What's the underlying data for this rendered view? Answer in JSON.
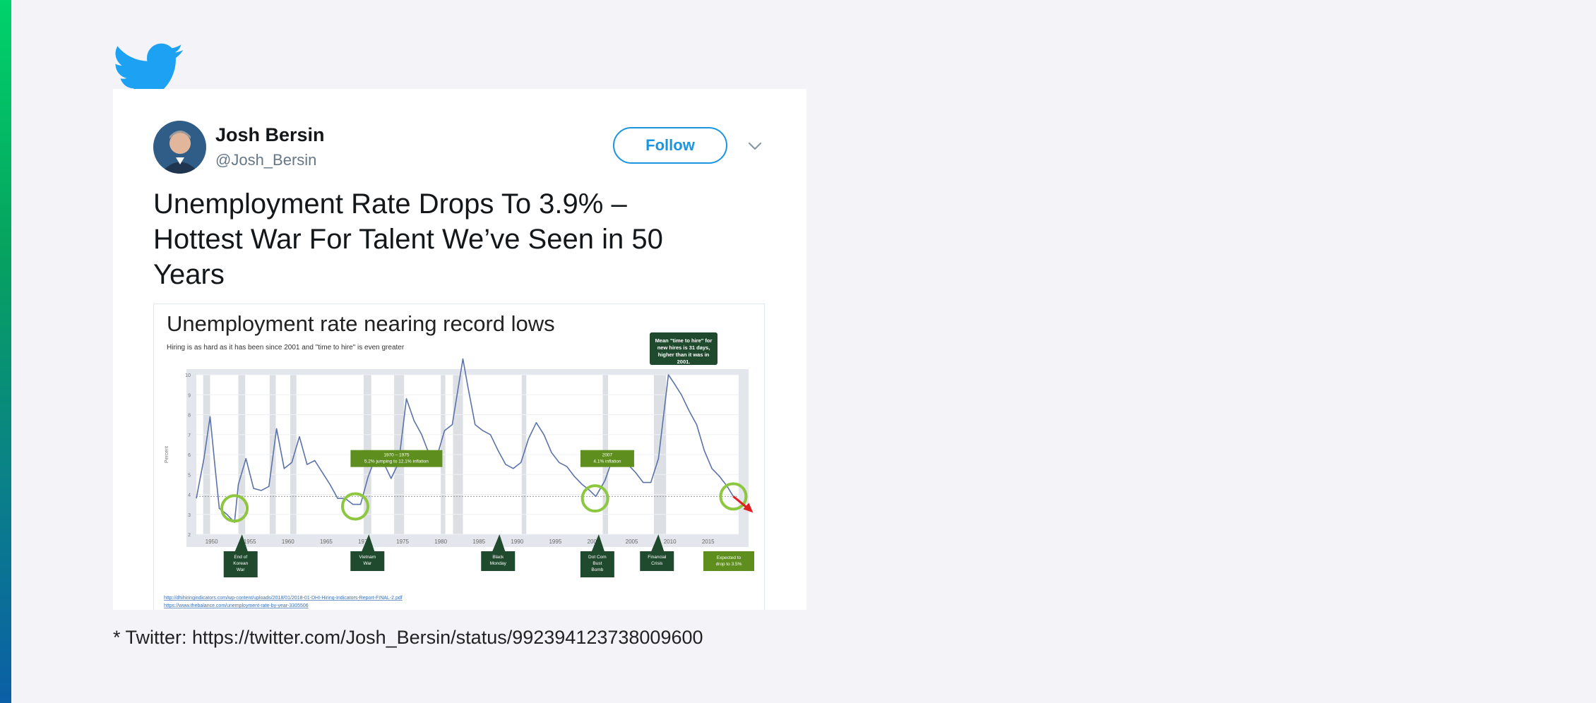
{
  "tweet": {
    "author_name": "Josh Bersin",
    "author_handle": "@Josh_Bersin",
    "follow_label": "Follow",
    "text": "Unemployment Rate Drops To 3.9% – Hottest War For Talent We’ve Seen in 50 Years"
  },
  "caption": "* Twitter: https://twitter.com/Josh_Bersin/status/992394123738009600",
  "colors": {
    "accent": "#1b95e0",
    "chart_line": "#5b73a8",
    "annotation_green": "#5e8f1e",
    "callout_dark": "#1f4a2e"
  },
  "chart_data": {
    "type": "line",
    "title": "Unemployment rate nearing record lows",
    "subtitle": "Hiring is as hard as it has been since 2001 and \"time to hire\" is even greater",
    "ylabel": "Percent",
    "xlim": [
      1948,
      2019
    ],
    "ylim": [
      2,
      10
    ],
    "x_ticks": [
      "1950",
      "1955",
      "1960",
      "1965",
      "1970",
      "1975",
      "1980",
      "1985",
      "1990",
      "1995",
      "2000",
      "2005",
      "2010",
      "2015"
    ],
    "y_ticks": [
      "2",
      "3",
      "4",
      "5",
      "6",
      "7",
      "8",
      "9",
      "10"
    ],
    "callout": "Mean \"time to hire\" for new hires is 31 days, higher than it was in 2001.",
    "annotations": [
      {
        "lines": [
          "1970 – 1975",
          "5.2% jumping to 12.1% inflation"
        ]
      },
      {
        "lines": [
          "2007",
          "4.1% inflation"
        ]
      }
    ],
    "events": [
      {
        "lines": [
          "End of",
          "Korean",
          "War"
        ]
      },
      {
        "lines": [
          "Vietnam",
          "War"
        ]
      },
      {
        "lines": [
          "Black",
          "Monday"
        ]
      },
      {
        "lines": [
          "Dot Com",
          "Bust",
          "Bomb"
        ]
      },
      {
        "lines": [
          "Financial",
          "Crisis"
        ]
      }
    ],
    "forecast_label": [
      "Expected to",
      "drop to 3.5%"
    ],
    "sources": [
      "http://dhihiringindicators.com/wp-content/uploads/2018/01/2018-01-DHI-Hiring-Indicators-Report-FINAL-2.pdf",
      "https://www.thebalance.com/unemployment-rate-by-year-3305506"
    ],
    "series": [
      {
        "x": [
          1948,
          1949,
          1949.8,
          1950.5,
          1951,
          1952,
          1953,
          1953.5,
          1954.5,
          1955.5,
          1956.5,
          1957.5,
          1958.5,
          1959.5,
          1960.5,
          1961.5,
          1962.5,
          1963.5,
          1964.5,
          1965.5,
          1966.5,
          1967.5,
          1968.5,
          1969.5,
          1970.5,
          1971.5,
          1972.5,
          1973.5,
          1974.5,
          1975.5,
          1976.5,
          1977.5,
          1978.5,
          1979.5,
          1980.5,
          1981.5,
          1982.9,
          1983.5,
          1984.5,
          1985.5,
          1986.5,
          1987.5,
          1988.5,
          1989.5,
          1990.5,
          1991.5,
          1992.5,
          1993.5,
          1994.5,
          1995.5,
          1996.5,
          1997.5,
          1998.5,
          1999.5,
          2000.3,
          2001.5,
          2002.5,
          2003.5,
          2004.5,
          2005.5,
          2006.5,
          2007.5,
          2008.5,
          2009.8,
          2010.5,
          2011.5,
          2012.5,
          2013.5,
          2014.5,
          2015.5,
          2016.5,
          2017.5,
          2018.3
        ],
        "y": [
          3.8,
          5.8,
          7.9,
          5.2,
          3.3,
          3.0,
          2.6,
          4.5,
          5.8,
          4.3,
          4.2,
          4.4,
          7.3,
          5.3,
          5.6,
          6.9,
          5.5,
          5.7,
          5.1,
          4.5,
          3.8,
          3.8,
          3.5,
          3.5,
          4.9,
          5.9,
          5.6,
          4.8,
          5.6,
          8.8,
          7.7,
          7.0,
          6.0,
          5.9,
          7.2,
          7.5,
          10.8,
          9.5,
          7.5,
          7.2,
          7.0,
          6.2,
          5.5,
          5.3,
          5.6,
          6.8,
          7.6,
          7.0,
          6.1,
          5.6,
          5.4,
          4.9,
          4.5,
          4.2,
          3.9,
          4.7,
          5.8,
          6.0,
          5.5,
          5.1,
          4.6,
          4.6,
          5.8,
          10.0,
          9.6,
          9.0,
          8.2,
          7.5,
          6.2,
          5.3,
          4.9,
          4.4,
          3.9
        ]
      }
    ]
  }
}
